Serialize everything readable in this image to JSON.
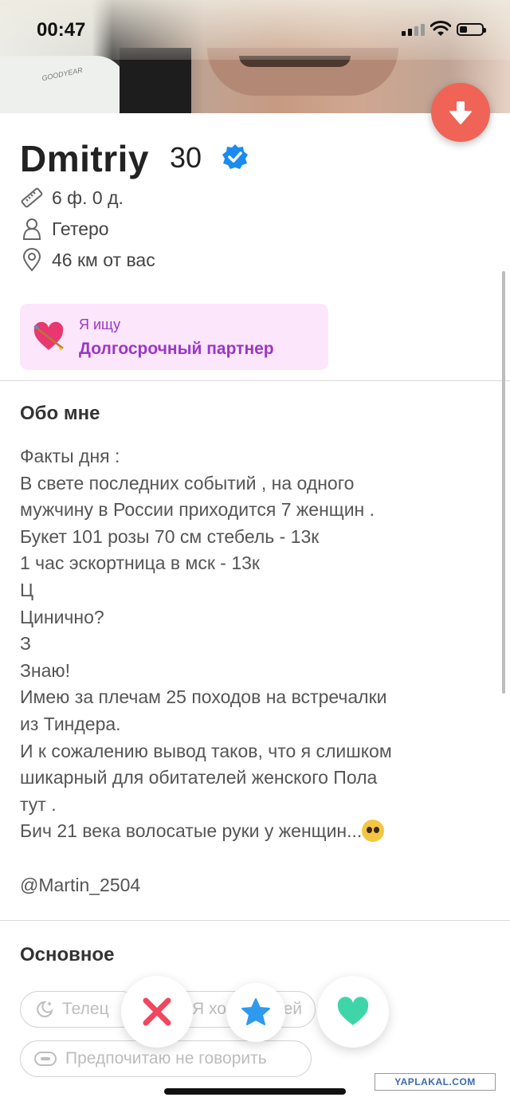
{
  "status_bar": {
    "time": "00:47"
  },
  "photo": {
    "logo_text": "GOODYEAR"
  },
  "profile": {
    "name": "Dmitriy",
    "age": "30",
    "height": "6 ф. 0 д.",
    "orientation": "Гетеро",
    "distance": "46 км от вас"
  },
  "looking_for": {
    "label": "Я ищу",
    "value": "Долгосрочный партнер"
  },
  "about": {
    "title": "Обо мне",
    "lines": [
      "Факты дня :",
      "В свете последних событий , на одного",
      "мужчину в России приходится 7 женщин .",
      "Букет 101 розы 70 см стебель - 13к",
      "1 час эскортница в мск - 13к",
      "Ц",
      "Цинично?",
      "З",
      "Знаю!",
      "Имею за плечам 25 походов на встречалки",
      "из Тиндера.",
      "И к сожалению вывод таков, что я слишком",
      "шикарный для обитателей женского Пола",
      "тут .",
      "Бич 21 века волосатые руки у женщин..."
    ],
    "handle": "@Martin_2504"
  },
  "basics": {
    "title": "Основное",
    "chips": [
      {
        "label": "Телец",
        "icon": "moon-star-icon"
      },
      {
        "label": "Я хо",
        "icon": ""
      },
      {
        "label": "ей",
        "icon": ""
      },
      {
        "label": "Предпочитаю не говорить",
        "icon": "pill-icon"
      }
    ]
  },
  "actions": {
    "nope": "close-icon",
    "super_like": "star-icon",
    "like": "heart-icon"
  },
  "watermark": "YAPLAKAL.COM",
  "colors": {
    "down_button": "#ef6456",
    "verified": "#1a8cf0",
    "looking_bg": "#fbe6fb",
    "looking_text": "#9b36c7",
    "nope": "#f0475e",
    "star": "#2d9af0",
    "like": "#3ed6a8"
  }
}
